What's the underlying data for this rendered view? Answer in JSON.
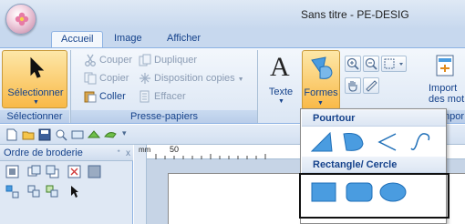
{
  "window": {
    "title": "Sans titre - PE-DESIG"
  },
  "tabs": [
    {
      "label": "Accueil",
      "active": true
    },
    {
      "label": "Image",
      "active": false
    },
    {
      "label": "Afficher",
      "active": false
    }
  ],
  "ribbon": {
    "select_button": "Sélectionner",
    "clipboard": {
      "cut": "Couper",
      "duplicate": "Dupliquer",
      "copy": "Copier",
      "copy_layout": "Disposition copies",
      "paste": "Coller",
      "delete": "Effacer"
    },
    "text_button": "Texte",
    "text_glyph": "A",
    "forms_button": "Formes",
    "import_button": "Import\ndes mot",
    "groups": {
      "select": "Sélectionner",
      "clipboard": "Presse-papiers",
      "import": "mpor"
    }
  },
  "panel": {
    "title": "Ordre de broderie",
    "pin": "ᐩ",
    "close": "x"
  },
  "ruler": {
    "unit": "mm",
    "mark_50": "50"
  },
  "dropdown": {
    "section_outline": "Pourtour",
    "section_rect_circle": "Rectangle/ Cercle"
  },
  "colors": {
    "accent_orange": "#f9b947",
    "shape_fill": "#4a9ce0",
    "shape_stroke": "#1f6fb8",
    "ribbon_text": "#15428b"
  }
}
